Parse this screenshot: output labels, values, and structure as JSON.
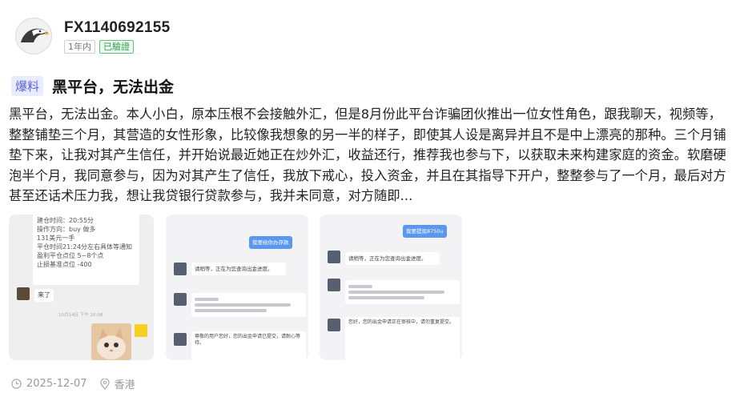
{
  "user": {
    "name": "FX1140692155",
    "badge_period": "1年内",
    "badge_verified": "已驗證"
  },
  "post": {
    "tag": "爆料",
    "title": "黑平台，无法出金",
    "body": "黑平台，无法出金。本人小白，原本压根不会接触外汇，但是8月份此平台诈骗团伙推出一位女性角色，跟我聊天，视频等，整整铺垫三个月，其营造的女性形象，比较像我想象的另一半的样子，即使其人设是离异并且不是中上漂亮的那种。三个月铺垫下来，让我对其产生信任，并开始说最近她正在炒外汇，收益还行，推荐我也参与下，以获取未来构建家庭的资金。软磨硬泡半个月，我同意参与，因为对其产生了信任，我放下戒心，投入资金，并且在其指导下开户，整整参与了一个月，最后对方甚至还话术压力我，想让我贷银行贷款参与，我并未同意，对方随即..."
  },
  "images": {
    "img1": {
      "lines": [
        "建仓时间：20:55分",
        "操作方向：buy 做多",
        "131美元一手",
        "平仓时间21:24分左右具体等通知",
        "盈利平仓点位 5~8个点",
        "止损基准点位 -400"
      ],
      "reply": "来了",
      "timestamp": "10月14日 下午 20:08"
    },
    "img2": {
      "blue_msg": "我要给你办存款",
      "msg1": "请稍等，正在为您查询出金进度。",
      "msg2": "尊敬的用户您好，您的出金申请已提交，请耐心等待。"
    },
    "img3": {
      "blue_msg": "我要提现8750u",
      "msg1": "请稍等，正在为您查询出金进度。",
      "msg2": "您好，您的出金申请正在审核中，请勿重复提交。"
    }
  },
  "footer": {
    "date": "2025-12-07",
    "location": "香港"
  }
}
